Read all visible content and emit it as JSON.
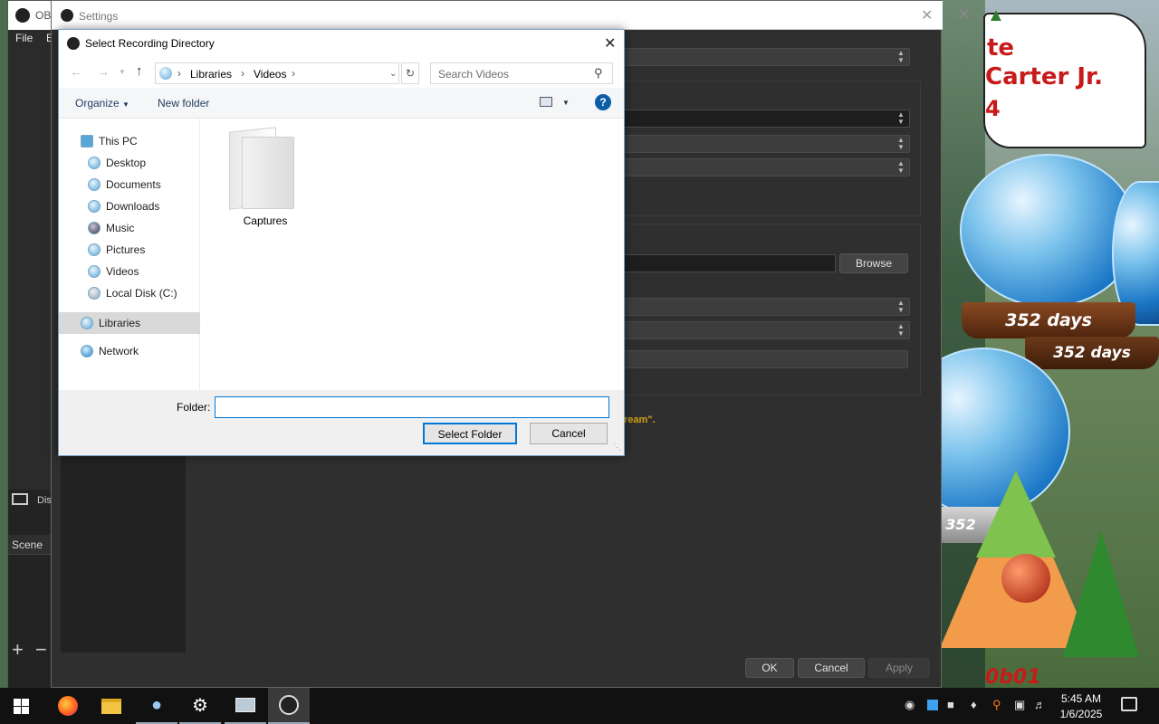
{
  "obs": {
    "title": "OBS",
    "menu": [
      "File",
      "E"
    ],
    "display_label": "Dis",
    "scenes_label": "Scene"
  },
  "settings": {
    "title": "Settings",
    "browse_label": "Browse",
    "warning_fragment": "ream\".",
    "ok_label": "OK",
    "cancel_label": "Cancel",
    "apply_label": "Apply"
  },
  "dialog": {
    "title": "Select Recording Directory",
    "breadcrumb": [
      "Libraries",
      "Videos"
    ],
    "search_placeholder": "Search Videos",
    "organize_label": "Organize",
    "new_folder_label": "New folder",
    "nav": {
      "this_pc": "This PC",
      "children": [
        "Desktop",
        "Documents",
        "Downloads",
        "Music",
        "Pictures",
        "Videos",
        "Local Disk (C:)"
      ],
      "libraries": "Libraries",
      "network": "Network"
    },
    "folder_item": "Captures",
    "folder_label": "Folder:",
    "folder_value": "",
    "select_label": "Select Folder",
    "cancel_label": "Cancel"
  },
  "widget": {
    "line1": "te",
    "line2": "Carter Jr.",
    "line3": "4",
    "globe_days": "352 days",
    "globe_days_small": "352 days",
    "globe_days_tiny": "352"
  },
  "desktop_bottom_text": "0b01",
  "taskbar": {
    "time": "5:45 AM",
    "date": "1/6/2025"
  },
  "colors": {
    "accent": "#0078d7",
    "settings_bg": "#2f2f2f",
    "warning": "#d4a017"
  }
}
